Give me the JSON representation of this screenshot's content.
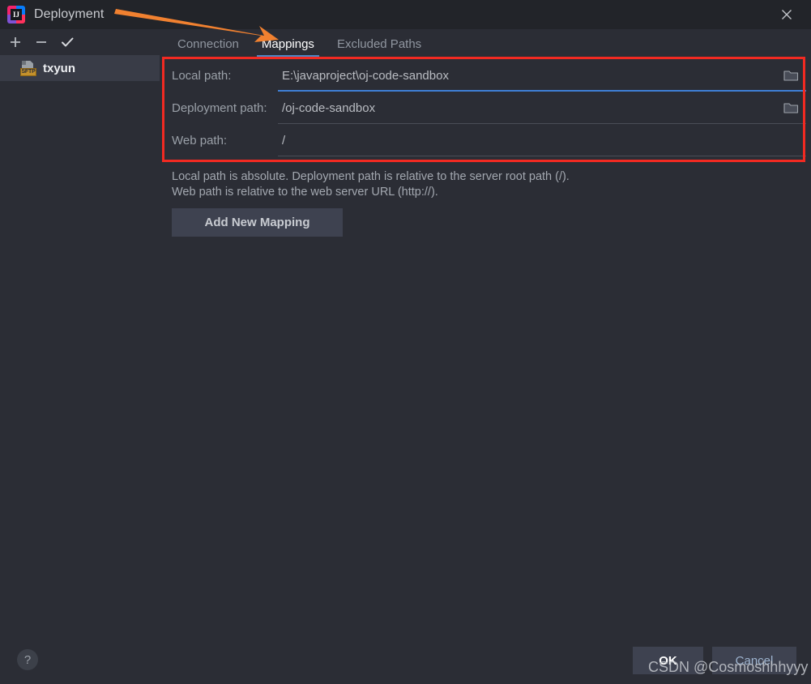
{
  "window": {
    "title": "Deployment",
    "logo_letters": "IJ",
    "close_icon": "close-icon"
  },
  "toolbar": {
    "add_icon": "plus-icon",
    "remove_icon": "minus-icon",
    "confirm_icon": "checkmark-icon"
  },
  "sidebar": {
    "items": [
      {
        "label": "txyun",
        "icon": "sftp-server-icon",
        "badge": "SFTP",
        "selected": true
      }
    ]
  },
  "tabs": [
    {
      "label": "Connection",
      "active": false
    },
    {
      "label": "Mappings",
      "active": true
    },
    {
      "label": "Excluded Paths",
      "active": false
    }
  ],
  "mappings": {
    "rows": [
      {
        "label": "Local path:",
        "value": "E:\\javaproject\\oj-code-sandbox",
        "focused": true,
        "has_browse": true,
        "browse_icon": "folder-icon"
      },
      {
        "label": "Deployment path:",
        "value": "/oj-code-sandbox",
        "focused": false,
        "has_browse": true,
        "browse_icon": "folder-icon"
      },
      {
        "label": "Web path:",
        "value": "/",
        "focused": false,
        "has_browse": false,
        "browse_icon": ""
      }
    ],
    "hint_line1": "Local path is absolute. Deployment path is relative to the server root path (/).",
    "hint_line2": "Web path is relative to the web server URL (http://).",
    "add_button": "Add New Mapping"
  },
  "footer": {
    "help_label": "?",
    "ok_label": "OK",
    "cancel_label": "Cancel"
  },
  "annotations": {
    "watermark": "CSDN @Cosmoshhhyyy",
    "highlight_color": "#f22a22",
    "arrow_color": "#f18130"
  }
}
